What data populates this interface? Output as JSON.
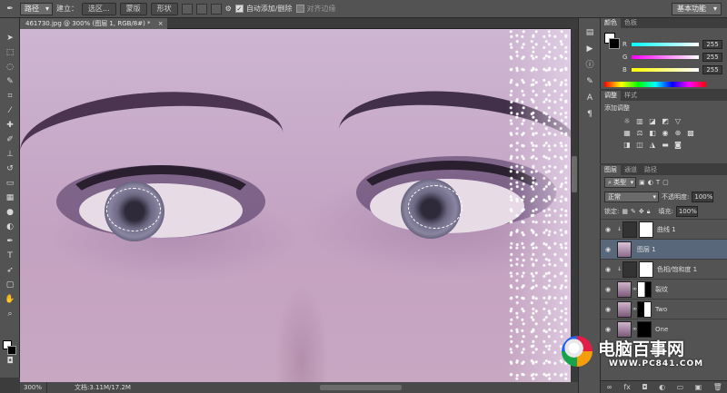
{
  "options": {
    "mode": "路径",
    "build_label": "建立：",
    "selection_btn": "选区...",
    "mask_btn": "蒙版",
    "shape_btn": "形状",
    "auto_add_label": "自动添加/删除",
    "align_edges_label": "对齐边缘",
    "workspace": "基本功能"
  },
  "document": {
    "tab_title": "461730.jpg @ 300% (图层 1, RGB/8#) *",
    "zoom": "300%",
    "doc_size": "文档:3.11M/17.2M"
  },
  "color_panel": {
    "tabs": [
      "颜色",
      "色板"
    ],
    "r_label": "R",
    "r_value": "255",
    "g_label": "G",
    "g_value": "255",
    "b_label": "B",
    "b_value": "255"
  },
  "adjust_panel": {
    "tabs": [
      "调整",
      "样式"
    ],
    "title": "添加调整"
  },
  "layers_panel": {
    "tabs": [
      "图层",
      "通道",
      "路径"
    ],
    "kind": "类型",
    "blend_mode": "正常",
    "opacity_label": "不透明度:",
    "opacity_value": "100%",
    "lock_label": "锁定:",
    "fill_label": "填充:",
    "fill_value": "100%",
    "layers": [
      {
        "name": "曲线 1"
      },
      {
        "name": "图层 1"
      },
      {
        "name": "色相/饱和度 1"
      },
      {
        "name": "裂纹"
      },
      {
        "name": "Two"
      },
      {
        "name": "One"
      }
    ]
  },
  "watermark": {
    "title": "电脑百事网",
    "url": "WWW.PC841.COM"
  }
}
